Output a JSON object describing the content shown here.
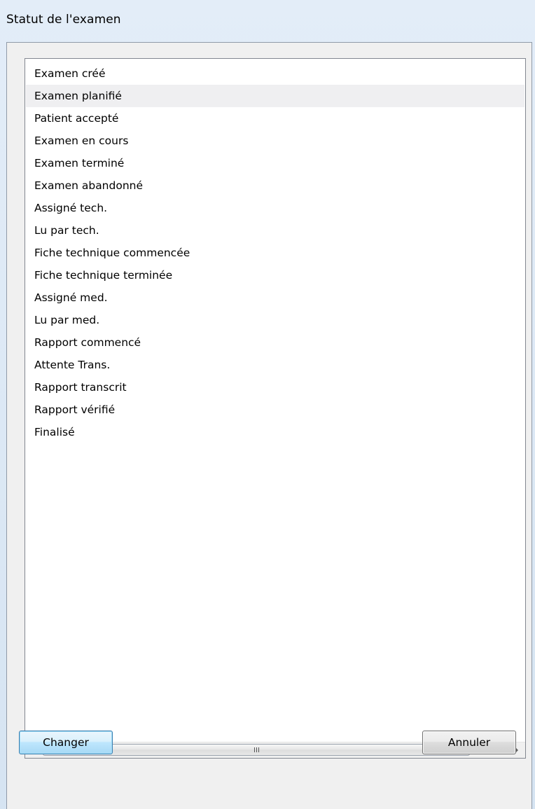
{
  "window": {
    "title": "Statut de l'examen"
  },
  "status_list": {
    "items": [
      "Examen créé",
      "Examen planifié",
      "Patient accepté",
      "Examen en cours",
      "Examen terminé",
      "Examen abandonné",
      "Assigné tech.",
      "Lu par tech.",
      "Fiche technique commencée",
      "Fiche technique terminée",
      "Assigné med.",
      "Lu par med.",
      "Rapport commencé",
      "Attente Trans.",
      "Rapport transcrit",
      "Rapport vérifié",
      "Finalisé"
    ],
    "hovered_index": 1
  },
  "scrollbar": {
    "left_icon": "scroll-left-arrow-icon",
    "right_icon": "scroll-right-arrow-icon",
    "thumb_icon": "grip-icon"
  },
  "buttons": {
    "change_label": "Changer",
    "cancel_label": "Annuler"
  },
  "colors": {
    "title_bar": "#dbe7f3",
    "client_bg": "#f0f0f0",
    "list_bg": "#ffffff",
    "hover_row": "#efeff1",
    "default_button_border": "#3c7fb1"
  }
}
